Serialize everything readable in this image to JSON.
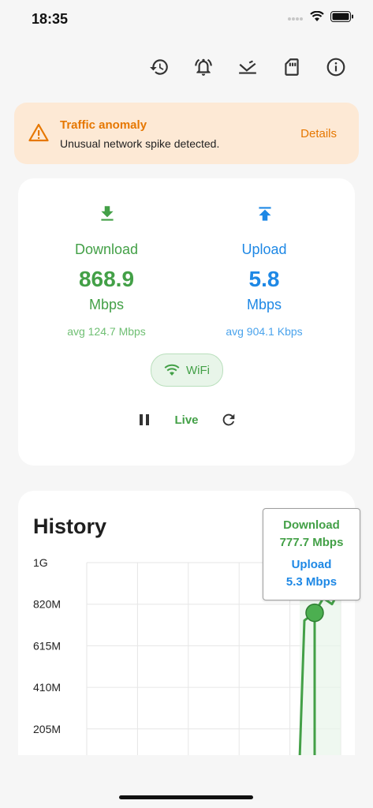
{
  "status_bar": {
    "time": "18:35"
  },
  "toolbar": {
    "icons": [
      "history-icon",
      "alarm-icon",
      "network-check-icon",
      "sd-card-icon",
      "info-icon"
    ]
  },
  "alert": {
    "title": "Traffic anomaly",
    "message": "Unusual network spike detected.",
    "action": "Details",
    "color": "#e67700",
    "background": "#fde9d5"
  },
  "speed": {
    "download": {
      "label": "Download",
      "value": "868.9",
      "unit": "Mbps",
      "avg": "avg 124.7 Mbps",
      "color": "#43a047"
    },
    "upload": {
      "label": "Upload",
      "value": "5.8",
      "unit": "Mbps",
      "avg": "avg 904.1 Kbps",
      "color": "#1e88e5"
    },
    "connection": "WiFi",
    "live_label": "Live"
  },
  "history": {
    "title": "History",
    "tooltip": {
      "download_label": "Download",
      "download_value": "777.7 Mbps",
      "upload_label": "Upload",
      "upload_value": "5.3 Mbps"
    }
  },
  "chart_data": {
    "type": "line",
    "title": "History",
    "y_ticks": [
      "1G",
      "820M",
      "615M",
      "410M",
      "205M"
    ],
    "ylim": [
      0,
      1025
    ],
    "grid": true,
    "series": [
      {
        "name": "Download",
        "color": "#43a047",
        "x": [
          0,
          1,
          2,
          3,
          4,
          5
        ],
        "values": [
          0,
          740,
          777.7,
          850,
          820,
          900
        ]
      }
    ]
  }
}
